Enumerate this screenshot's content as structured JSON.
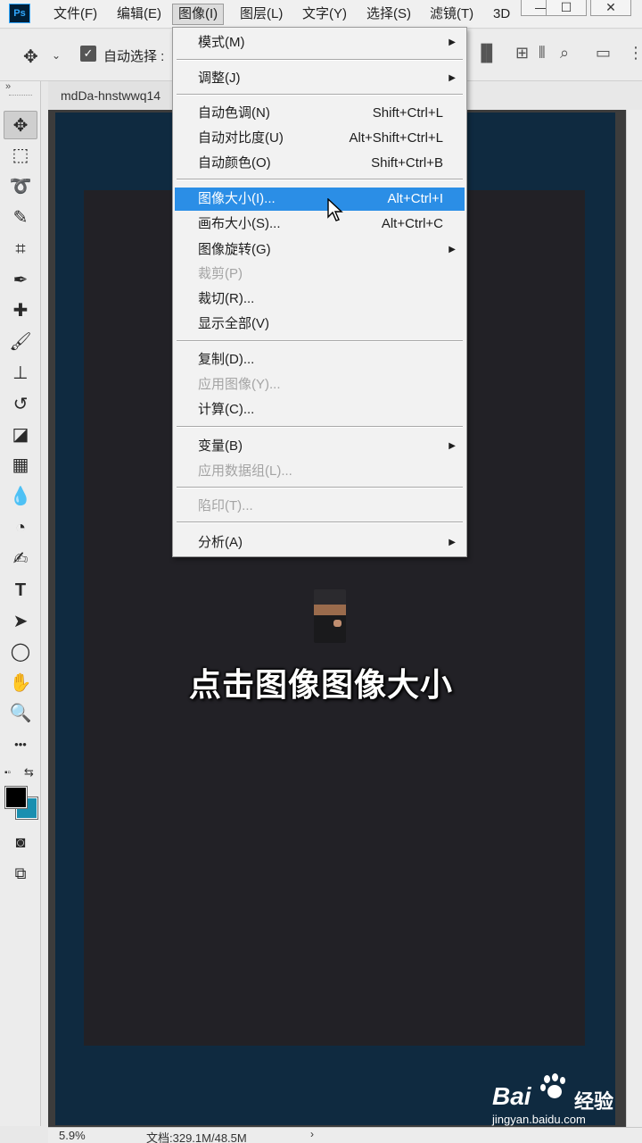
{
  "app": {
    "logo": "Ps",
    "menus": [
      "文件(F)",
      "编辑(E)",
      "图像(I)",
      "图层(L)",
      "文字(Y)",
      "选择(S)",
      "滤镜(T)",
      "3D"
    ],
    "window_controls": [
      "—",
      "☐",
      "✕"
    ]
  },
  "options_bar": {
    "move_icon": "✥",
    "dropdown_glyph": "⌄",
    "auto_select_label": "自动选择 :",
    "right_icons": [
      "▐▌",
      "⊞",
      "⫴",
      "⌕",
      "▭",
      "⋮"
    ]
  },
  "document": {
    "tab_title": "mdDa-hnstwwq14",
    "caption": "点击图像图像大小"
  },
  "status": {
    "zoom": "5.9%",
    "doc_info": "文档:329.1M/48.5M",
    "arrow": "›"
  },
  "watermark": {
    "brand": "Bai",
    "jingyan": "经验",
    "url": "jingyan.baidu.com"
  },
  "toolbar": {
    "collapse_glyph": "»",
    "tools": [
      {
        "name": "move-tool",
        "glyph": "✥"
      },
      {
        "name": "marquee-tool",
        "glyph": "⬚"
      },
      {
        "name": "lasso-tool",
        "glyph": "➰"
      },
      {
        "name": "quick-select-tool",
        "glyph": "✎"
      },
      {
        "name": "crop-tool",
        "glyph": "⌗"
      },
      {
        "name": "eyedropper-tool",
        "glyph": "✒"
      },
      {
        "name": "healing-tool",
        "glyph": "✚"
      },
      {
        "name": "brush-tool",
        "glyph": "🖌"
      },
      {
        "name": "stamp-tool",
        "glyph": "⊥"
      },
      {
        "name": "history-brush-tool",
        "glyph": "↺"
      },
      {
        "name": "eraser-tool",
        "glyph": "◪"
      },
      {
        "name": "gradient-tool",
        "glyph": "▦"
      },
      {
        "name": "blur-tool",
        "glyph": "💧"
      },
      {
        "name": "dodge-tool",
        "glyph": "◔"
      },
      {
        "name": "pen-tool",
        "glyph": "✍"
      },
      {
        "name": "type-tool",
        "glyph": "T"
      },
      {
        "name": "path-select-tool",
        "glyph": "➤"
      },
      {
        "name": "ellipse-tool",
        "glyph": "◯"
      },
      {
        "name": "hand-tool",
        "glyph": "✋"
      },
      {
        "name": "zoom-tool",
        "glyph": "🔍"
      },
      {
        "name": "more-tools",
        "glyph": "•••"
      }
    ],
    "swatch_mini": "▪▫",
    "swatch_swap": "⇆",
    "quick_mask_glyph": "◙",
    "screen_mode_glyph": "⧉",
    "foreground_color": "#000000",
    "background_color": "#1a8fb0"
  },
  "image_menu": {
    "items": [
      {
        "label": "模式(M)",
        "shortcut": "",
        "submenu": true,
        "disabled": false
      },
      {
        "label": "调整(J)",
        "shortcut": "",
        "submenu": true,
        "disabled": false
      },
      {
        "label": "自动色调(N)",
        "shortcut": "Shift+Ctrl+L",
        "submenu": false,
        "disabled": false
      },
      {
        "label": "自动对比度(U)",
        "shortcut": "Alt+Shift+Ctrl+L",
        "submenu": false,
        "disabled": false
      },
      {
        "label": "自动颜色(O)",
        "shortcut": "Shift+Ctrl+B",
        "submenu": false,
        "disabled": false
      },
      {
        "label": "图像大小(I)...",
        "shortcut": "Alt+Ctrl+I",
        "submenu": false,
        "disabled": false,
        "highlighted": true
      },
      {
        "label": "画布大小(S)...",
        "shortcut": "Alt+Ctrl+C",
        "submenu": false,
        "disabled": false
      },
      {
        "label": "图像旋转(G)",
        "shortcut": "",
        "submenu": true,
        "disabled": false
      },
      {
        "label": "裁剪(P)",
        "shortcut": "",
        "submenu": false,
        "disabled": true
      },
      {
        "label": "裁切(R)...",
        "shortcut": "",
        "submenu": false,
        "disabled": false
      },
      {
        "label": "显示全部(V)",
        "shortcut": "",
        "submenu": false,
        "disabled": false
      },
      {
        "label": "复制(D)...",
        "shortcut": "",
        "submenu": false,
        "disabled": false
      },
      {
        "label": "应用图像(Y)...",
        "shortcut": "",
        "submenu": false,
        "disabled": true
      },
      {
        "label": "计算(C)...",
        "shortcut": "",
        "submenu": false,
        "disabled": false
      },
      {
        "label": "变量(B)",
        "shortcut": "",
        "submenu": true,
        "disabled": false
      },
      {
        "label": "应用数据组(L)...",
        "shortcut": "",
        "submenu": false,
        "disabled": true
      },
      {
        "label": "陷印(T)...",
        "shortcut": "",
        "submenu": false,
        "disabled": true
      },
      {
        "label": "分析(A)",
        "shortcut": "",
        "submenu": true,
        "disabled": false
      }
    ],
    "submenu_arrow": "▶"
  },
  "colors": {
    "accent_highlight": "#2b8ee6",
    "document_border": "#0f2a40",
    "canvas_fill": "#222126"
  }
}
